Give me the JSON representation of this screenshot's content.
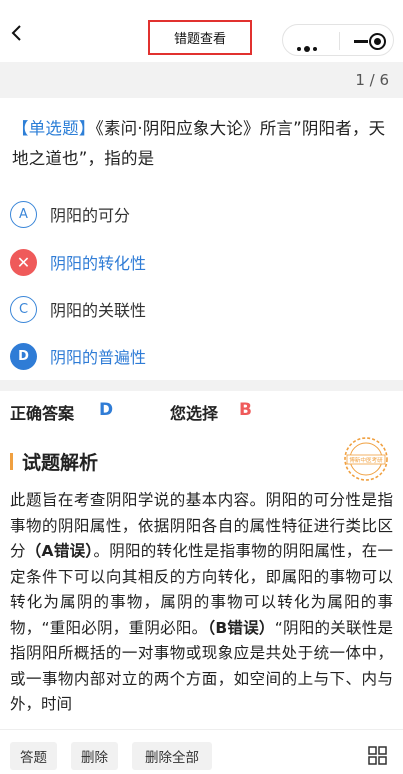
{
  "nav": {
    "back_icon": "chevron-left-icon",
    "title": "错题查看",
    "capsule": {
      "more_icon": "more-dots-icon",
      "minimize_icon": "minimize-icon",
      "close_icon": "record-circle-icon"
    }
  },
  "progress": {
    "text": "1 / 6"
  },
  "question": {
    "type_label": "【单选题】",
    "text": "《素问·阴阳应象大论》所言”阴阳者，天地之道也”，指的是"
  },
  "options": [
    {
      "letter": "A",
      "text": "阴阳的可分",
      "state": "normal"
    },
    {
      "letter": "✕",
      "text": "阴阳的转化性",
      "state": "wrong"
    },
    {
      "letter": "C",
      "text": "阴阳的关联性",
      "state": "normal"
    },
    {
      "letter": "D",
      "text": "阴阳的普遍性",
      "state": "correct"
    }
  ],
  "answer": {
    "correct_label": "正确答案",
    "correct_value": "D",
    "chosen_label": "您选择",
    "chosen_value": "B"
  },
  "analysis": {
    "title": "试题解析",
    "stamp_text": "博新中医考研",
    "p1": "此题旨在考查阴阳学说的基本内容。阴阳的可分性是指事物的阴阳属性，依据阴阳各自的属性特征进行类比区分",
    "tag1": "（A错误）",
    "p2": "。阴阳的转化性是指事物的阴阳属性，在一定条件下可以向其相反的方向转化，即属阳的事物可以转化为属阴的事物，属阴的事物可以转化为属阳的事物，“重阳必阴，重阴必阳。",
    "tag2": "（B错误）",
    "p3": "“阴阳的关联性是指阴阳所概括的一对事物或现象应是共处于统一体中，或一事物内部对立的两个方面，如空间的上与下、内与外，时间"
  },
  "toolbar": {
    "buttons": [
      "答题",
      "删除",
      "删除全部"
    ],
    "grid_icon": "grid-icon"
  },
  "colors": {
    "accent": "#2f7cd6",
    "wrong": "#ef5a5a",
    "highlight": "#e1312f",
    "orange": "#f0a040"
  }
}
